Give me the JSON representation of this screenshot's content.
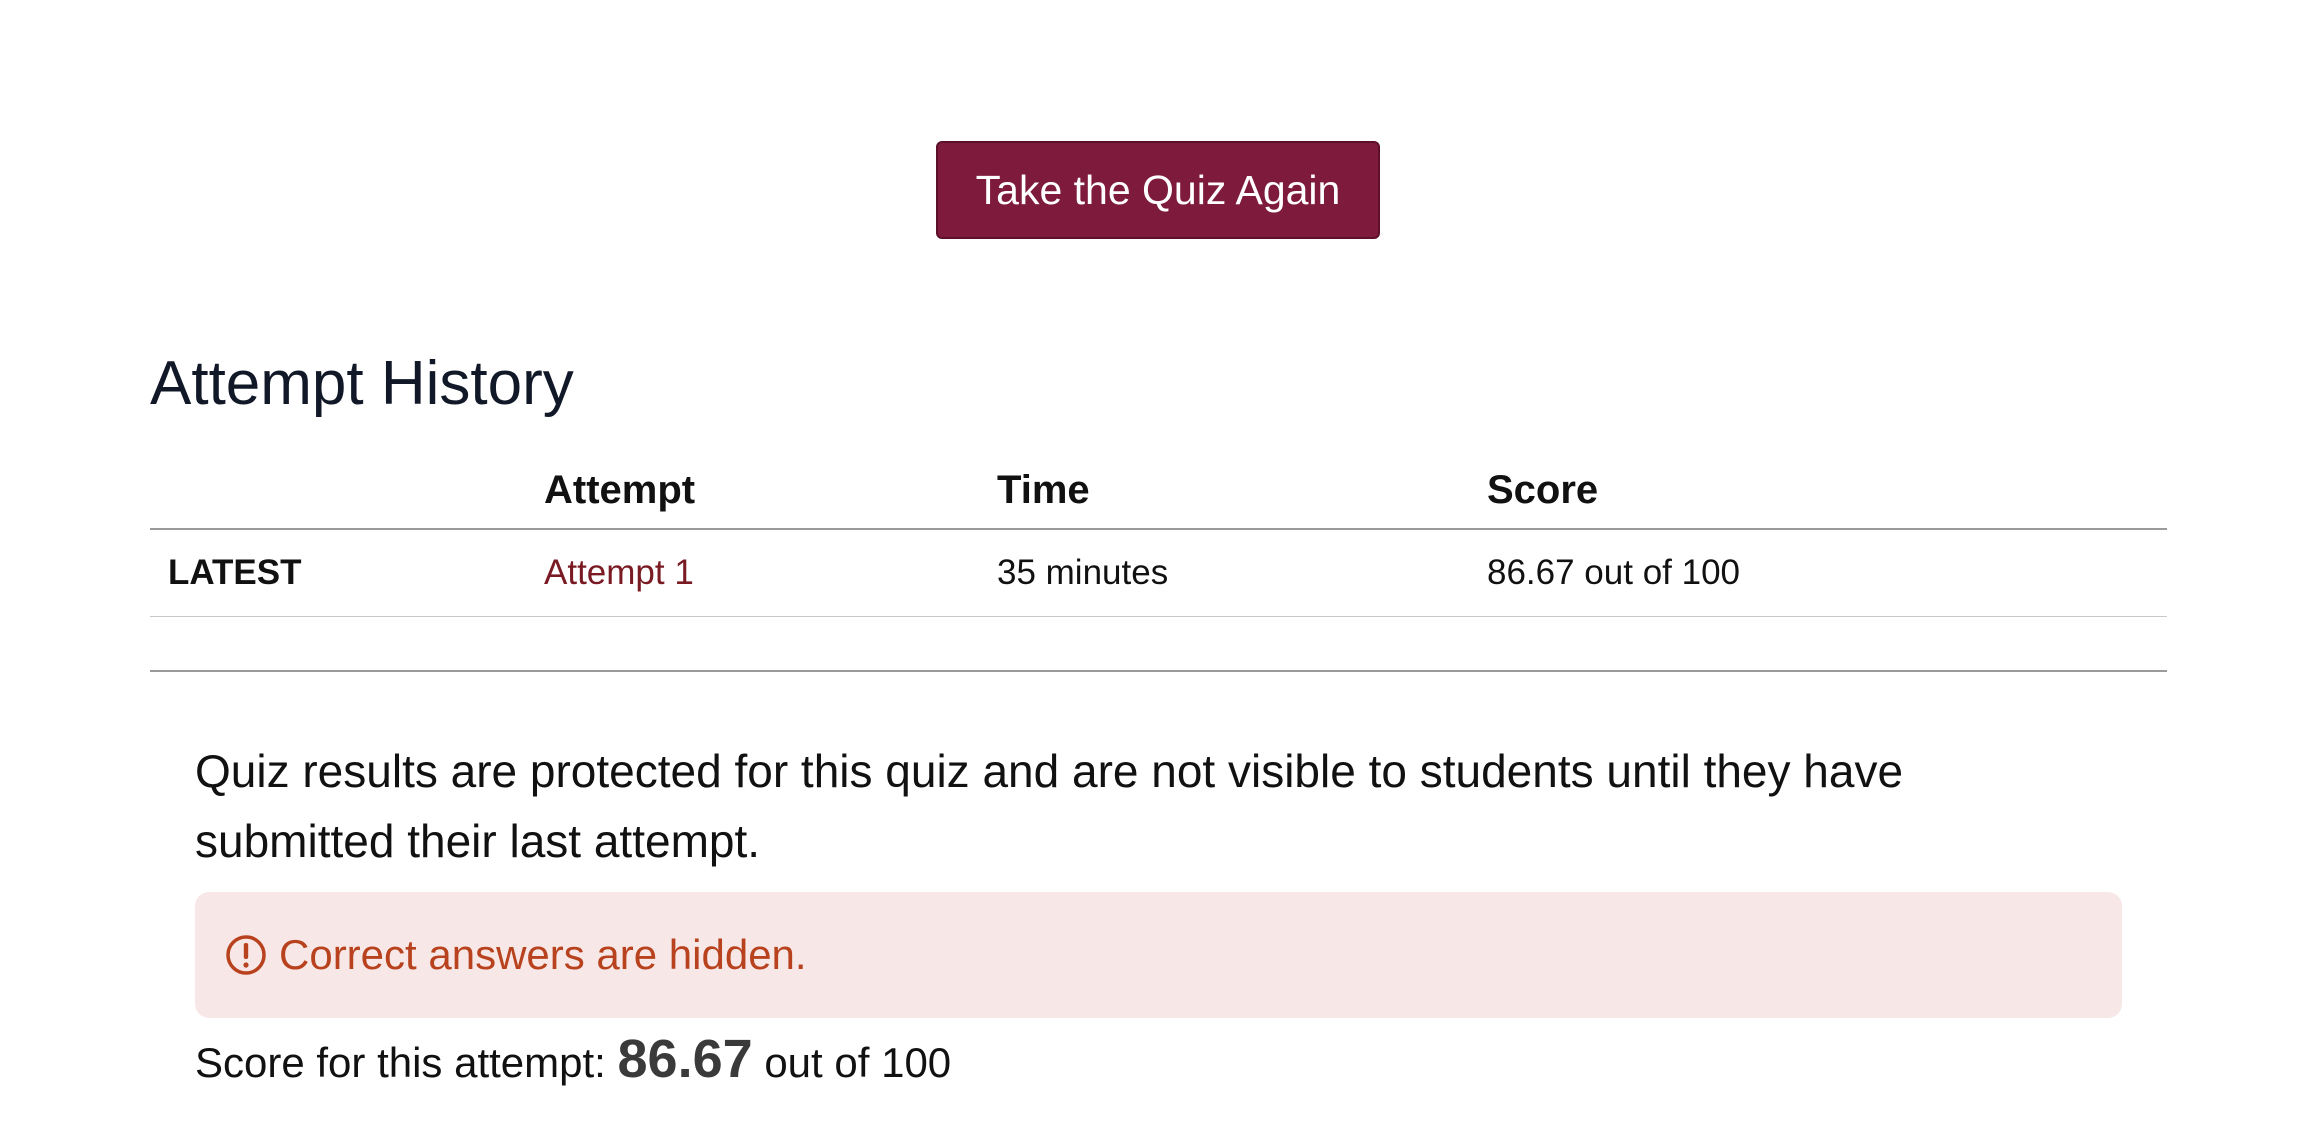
{
  "actions": {
    "retake_label": "Take the Quiz Again"
  },
  "history": {
    "title": "Attempt History",
    "columns": [
      "",
      "Attempt",
      "Time",
      "Score"
    ],
    "rows": [
      {
        "tag": "LATEST",
        "attempt": "Attempt 1",
        "time": "35 minutes",
        "score": "86.67 out of 100"
      }
    ]
  },
  "results": {
    "protected_message": "Quiz results are protected for this quiz and are not visible to students until they have submitted their last attempt.",
    "alert_icon": "exclamation-circle-icon",
    "alert_text": "Correct answers are hidden.",
    "alert_color": "#b8421e",
    "score_prefix": "Score for this attempt:",
    "score_value": "86.67",
    "score_suffix": "out of 100"
  },
  "colors": {
    "button_bg": "#7e1a3b",
    "link": "#7a1b24",
    "alert_bg": "#f7e8e7"
  }
}
